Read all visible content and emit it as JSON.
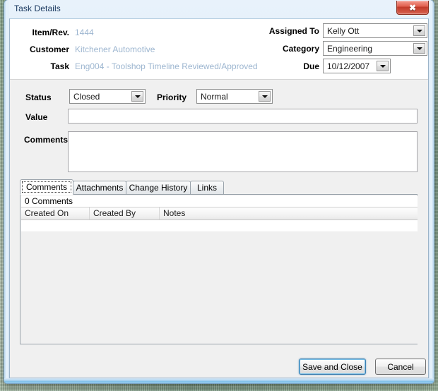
{
  "window": {
    "title": "Task Details",
    "close_icon": "close-icon",
    "close_glyph": "✖"
  },
  "header": {
    "fields": [
      {
        "label": "Item/Rev.",
        "value": "1444"
      },
      {
        "label": "Customer",
        "value": "Kitchener Automotive"
      },
      {
        "label": "Task",
        "value": "Eng004 - Toolshop Timeline Reviewed/Approved"
      }
    ],
    "assigned_to": {
      "label": "Assigned To",
      "value": "Kelly Ott"
    },
    "category": {
      "label": "Category",
      "value": "Engineering"
    },
    "due": {
      "label": "Due",
      "value": "10/12/2007"
    }
  },
  "form": {
    "status": {
      "label": "Status",
      "value": "Closed"
    },
    "priority": {
      "label": "Priority",
      "value": "Normal"
    },
    "value_field": {
      "label": "Value",
      "value": "",
      "placeholder": ""
    },
    "comments_field": {
      "label": "Comments",
      "value": "",
      "placeholder": ""
    }
  },
  "tabs": [
    {
      "label": "Comments",
      "active": true
    },
    {
      "label": "Attachments",
      "active": false
    },
    {
      "label": "Change History",
      "active": false
    },
    {
      "label": "Links",
      "active": false
    }
  ],
  "grid": {
    "caption": "0 Comments",
    "columns": [
      "Created On",
      "Created By",
      "Notes"
    ],
    "rows": []
  },
  "footer": {
    "save_label": "Save and Close",
    "cancel_label": "Cancel"
  },
  "colors": {
    "title_text": "#17365d",
    "link_value": "#9db6d0",
    "close_button": "#c23b2a",
    "default_button_border": "#3c7fb1",
    "client_background": "#f0f0f0"
  }
}
